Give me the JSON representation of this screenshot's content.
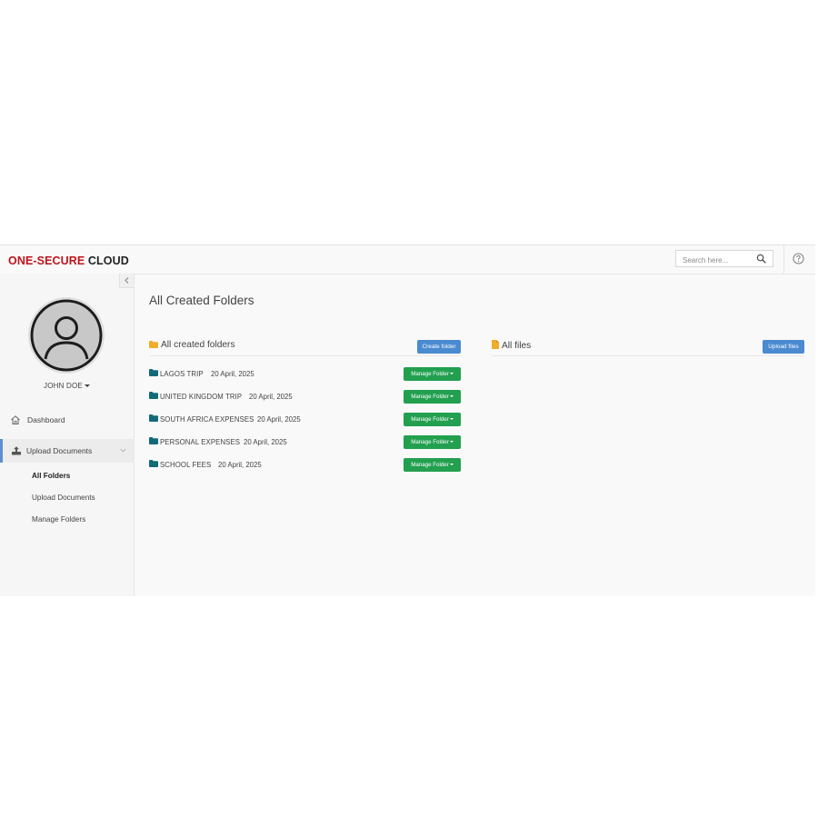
{
  "header": {
    "brand_part1": "ONE-SECURE",
    "brand_part2": "CLOUD",
    "search_placeholder": "Search here..."
  },
  "sidebar": {
    "user_name": "JOHN DOE",
    "nav": [
      {
        "label": "Dashboard",
        "icon": "home-icon"
      },
      {
        "label": "Upload Documents",
        "icon": "upload-icon",
        "active": true
      }
    ],
    "sub_items": [
      "All Folders",
      "Upload Documents",
      "Manage Folders"
    ]
  },
  "main": {
    "page_title": "All Created Folders",
    "folders_panel_title": "All created folders",
    "create_button": "Create folder",
    "files_panel_title": "All files",
    "upload_button": "Upload files",
    "manage_label": "Manage Folder",
    "folders": [
      {
        "name": "LAGOS TRIP",
        "date": "20 April, 2025"
      },
      {
        "name": "UNITED KINGDOM TRIP",
        "date": "20 April, 2025"
      },
      {
        "name": "SOUTH AFRICA EXPENSES",
        "date": "20 April, 2025"
      },
      {
        "name": "PERSONAL EXPENSES",
        "date": "20 April, 2025"
      },
      {
        "name": "SCHOOL FEES",
        "date": "20 April, 2025"
      }
    ]
  },
  "colors": {
    "brand_red": "#c0141b",
    "primary_blue": "#4a8ad0",
    "success_green": "#22a04f",
    "folder_teal": "#126a78",
    "folder_yellow": "#f0ad2a"
  }
}
